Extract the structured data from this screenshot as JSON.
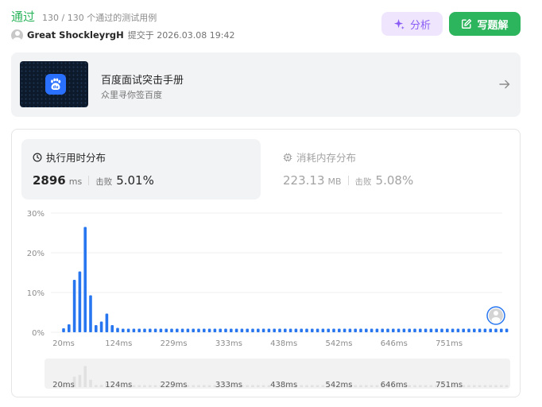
{
  "header": {
    "status": "通过",
    "tests": "130 / 130 个通过的测试用例",
    "author": "Great ShockleyrgH",
    "submitted": "提交于 2026.03.08 19:42",
    "analyze_label": "分析",
    "solution_label": "写题解"
  },
  "banner": {
    "title": "百度面试突击手册",
    "subtitle": "众里寻你签百度"
  },
  "runtime": {
    "title": "执行用时分布",
    "value": "2896",
    "unit": "ms",
    "beats_label": "击败",
    "beats": "5.01%"
  },
  "memory": {
    "title": "消耗内存分布",
    "value": "223.13",
    "unit": "MB",
    "beats_label": "击败",
    "beats": "5.08%"
  },
  "colors": {
    "accent": "#2db55d",
    "bar": "#2776f0",
    "analyze": "#8a5cf5"
  },
  "chart_data": {
    "type": "bar",
    "ylabel": "",
    "xlabel": "",
    "ylim": [
      0,
      30
    ],
    "yticks": [
      "30%",
      "20%",
      "10%",
      "0%"
    ],
    "ytick_values": [
      30,
      20,
      10,
      0
    ],
    "xticks": [
      "20ms",
      "124ms",
      "229ms",
      "333ms",
      "438ms",
      "542ms",
      "646ms",
      "751ms"
    ],
    "values": [
      1,
      2,
      13.2,
      15.3,
      26.5,
      9.3,
      1.8,
      2.7,
      4.7,
      1.8,
      1.1,
      0.9,
      0.9,
      0.9,
      0.9,
      0.9,
      0.9,
      0.9,
      0.9,
      0.9,
      0.9,
      0.9,
      0.9,
      0.9,
      0.9,
      0.9,
      0.9,
      0.9,
      0.9,
      0.9,
      0.9,
      0.9,
      0.9,
      0.9,
      0.9,
      0.9,
      0.9,
      0.9,
      0.9,
      0.9,
      0.9,
      0.9,
      0.9,
      0.9,
      0.9,
      0.9,
      0.9,
      0.9,
      0.9,
      0.9,
      0.9,
      0.9,
      0.9,
      0.9,
      0.9,
      0.9,
      0.9,
      0.9,
      0.9,
      0.9,
      0.9,
      0.9,
      0.9,
      0.9,
      0.9,
      0.9,
      0.9,
      0.9,
      0.9,
      0.9,
      0.9,
      0.9,
      0.9,
      0.9,
      0.9,
      0.9,
      0.9,
      0.9,
      0.9,
      0.9,
      0.9,
      0.9,
      0.9
    ],
    "highlight_index": 81,
    "grid": true,
    "legend": "none"
  }
}
